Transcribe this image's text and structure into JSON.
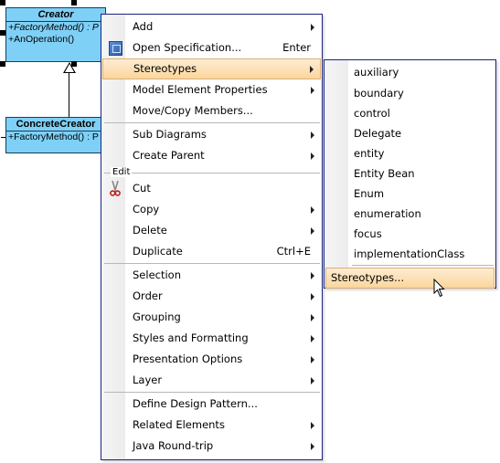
{
  "diagram": {
    "classes": [
      {
        "name": "Creator",
        "name_italic": true,
        "operations": [
          {
            "text": "+FactoryMethod() : P",
            "italic": true
          },
          {
            "text": "+AnOperation()",
            "italic": false
          }
        ]
      },
      {
        "name": "ConcreteCreator",
        "name_italic": false,
        "operations": [
          {
            "text": "+FactoryMethod() : P",
            "italic": false
          }
        ]
      }
    ],
    "colors": {
      "class_fill": "#7fd0f6",
      "class_border": "#1a3c5a"
    }
  },
  "context_menu": {
    "items": [
      {
        "label": "Add",
        "submenu": true
      },
      {
        "label": "Open Specification...",
        "shortcut": "Enter",
        "icon": "specification-icon"
      },
      {
        "label": "Stereotypes",
        "submenu": true,
        "highlighted": true
      },
      {
        "label": "Model Element Properties",
        "submenu": true
      },
      {
        "label": "Move/Copy Members..."
      },
      {
        "label": "Sub Diagrams",
        "submenu": true
      },
      {
        "label": "Create Parent",
        "submenu": true
      },
      {
        "label": "Cut",
        "icon": "scissors-icon"
      },
      {
        "label": "Copy",
        "submenu": true
      },
      {
        "label": "Delete",
        "submenu": true
      },
      {
        "label": "Duplicate",
        "shortcut": "Ctrl+E"
      },
      {
        "label": "Selection",
        "submenu": true
      },
      {
        "label": "Order",
        "submenu": true
      },
      {
        "label": "Grouping",
        "submenu": true
      },
      {
        "label": "Styles and Formatting",
        "submenu": true
      },
      {
        "label": "Presentation Options",
        "submenu": true
      },
      {
        "label": "Layer",
        "submenu": true
      },
      {
        "label": "Define Design Pattern..."
      },
      {
        "label": "Related Elements",
        "submenu": true
      },
      {
        "label": "Java Round-trip",
        "submenu": true
      }
    ],
    "group_title_edit": "Edit"
  },
  "stereotypes_submenu": {
    "items": [
      "auxiliary",
      "boundary",
      "control",
      "Delegate",
      "entity",
      "Entity Bean",
      "Enum",
      "enumeration",
      "focus",
      "implementationClass"
    ],
    "more_label": "Stereotypes..."
  },
  "colors": {
    "highlight_top": "#fdecd2",
    "highlight_bottom": "#fbd69c",
    "menu_border": "#1a237e"
  }
}
